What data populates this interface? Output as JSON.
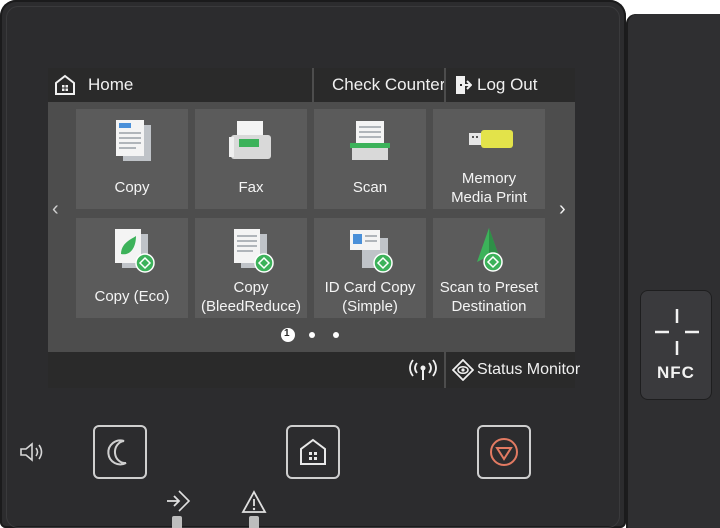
{
  "header": {
    "home_label": "Home",
    "check_counter_label": "Check Counter",
    "logout_label": "Log Out"
  },
  "tiles": [
    {
      "label": "Copy",
      "icon": "copy-icon"
    },
    {
      "label": "Fax",
      "icon": "fax-icon"
    },
    {
      "label": "Scan",
      "icon": "scan-icon"
    },
    {
      "label": "Memory\nMedia Print",
      "icon": "memory-media-icon"
    },
    {
      "label": "Copy (Eco)",
      "icon": "copy-eco-icon"
    },
    {
      "label": "Copy\n(BleedReduce)",
      "icon": "copy-bleed-icon"
    },
    {
      "label": "ID Card Copy\n(Simple)",
      "icon": "id-card-copy-icon"
    },
    {
      "label": "Scan to Preset\nDestination",
      "icon": "scan-preset-icon"
    }
  ],
  "pager": {
    "pages": 3,
    "current": 1,
    "current_label": "1"
  },
  "footer": {
    "status_monitor_label": "Status Monitor"
  },
  "side": {
    "nfc_label": "NFC"
  },
  "colors": {
    "accent_green": "#3cb25a",
    "screen_bg": "#4d4d4d",
    "tile_bg": "#5b5b5b",
    "bar_bg": "#2a2a2a"
  }
}
